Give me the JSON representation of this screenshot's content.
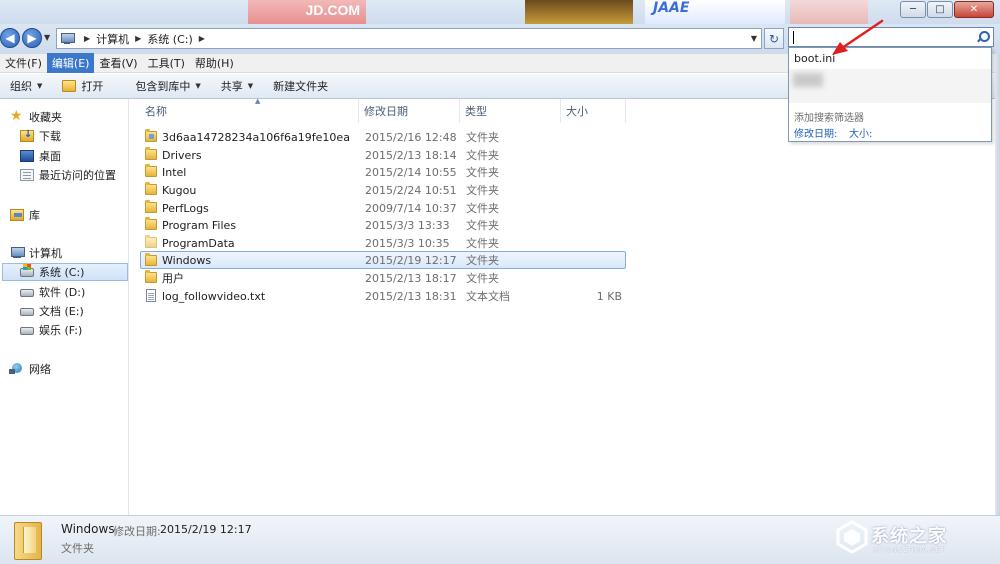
{
  "window": {
    "banner_jd": "JD.COM",
    "banner_blue": "JAAE",
    "minimize": "─",
    "maximize": "□",
    "close": "✕"
  },
  "address": {
    "crumbs": [
      "计算机",
      "系统 (C:)"
    ],
    "back": "◀",
    "forward": "▶",
    "refresh": "↻"
  },
  "search": {
    "suggestion": "boot.ini",
    "filter_label": "添加搜索筛选器",
    "filter_date": "修改日期:",
    "filter_size": "大小:"
  },
  "menu": [
    "文件(F)",
    "编辑(E)",
    "查看(V)",
    "工具(T)",
    "帮助(H)"
  ],
  "menu_active_index": 1,
  "commands": {
    "organize": "组织",
    "open": "打开",
    "include_library": "包含到库中",
    "share": "共享",
    "new_folder": "新建文件夹"
  },
  "nav": {
    "favorites": "收藏夹",
    "downloads": "下载",
    "desktop": "桌面",
    "recent": "最近访问的位置",
    "libraries": "库",
    "computer": "计算机",
    "drive_c": "系统 (C:)",
    "drive_d": "软件 (D:)",
    "drive_e": "文档 (E:)",
    "drive_f": "娱乐 (F:)",
    "network": "网络"
  },
  "columns": {
    "name": "名称",
    "date": "修改日期",
    "type": "类型",
    "size": "大小"
  },
  "files": [
    {
      "name": "3d6aa14728234a106f6a19fe10ea",
      "date": "2015/2/16 12:48",
      "type": "文件夹",
      "size": ""
    },
    {
      "name": "Drivers",
      "date": "2015/2/13 18:14",
      "type": "文件夹",
      "size": ""
    },
    {
      "name": "Intel",
      "date": "2015/2/14 10:55",
      "type": "文件夹",
      "size": ""
    },
    {
      "name": "Kugou",
      "date": "2015/2/24 10:51",
      "type": "文件夹",
      "size": ""
    },
    {
      "name": "PerfLogs",
      "date": "2009/7/14 10:37",
      "type": "文件夹",
      "size": ""
    },
    {
      "name": "Program Files",
      "date": "2015/3/3 13:33",
      "type": "文件夹",
      "size": ""
    },
    {
      "name": "ProgramData",
      "date": "2015/3/3 10:35",
      "type": "文件夹",
      "size": ""
    },
    {
      "name": "Windows",
      "date": "2015/2/19 12:17",
      "type": "文件夹",
      "size": ""
    },
    {
      "name": "用户",
      "date": "2015/2/13 18:17",
      "type": "文件夹",
      "size": ""
    },
    {
      "name": "log_followvideo.txt",
      "date": "2015/2/13 18:31",
      "type": "文本文档",
      "size": "1 KB"
    }
  ],
  "details": {
    "name": "Windows",
    "date_label": "修改日期:",
    "date": "2015/2/19 12:17",
    "type": "文件夹"
  },
  "watermark": {
    "text": "系统之家",
    "sub": "XITONGZHIJIA.NET"
  },
  "colors": {
    "accent": "#3b78c9",
    "selection_border": "#84acdd",
    "arrow": "#e02020"
  }
}
